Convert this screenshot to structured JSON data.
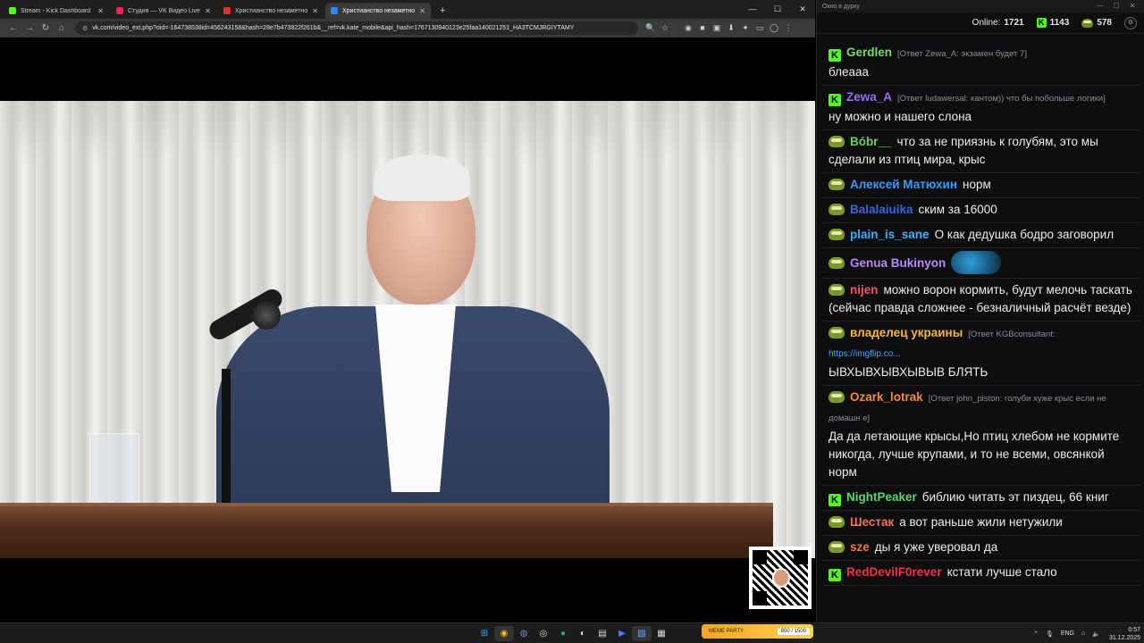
{
  "browser": {
    "tabs": [
      {
        "title": "Stream - Kick Dashboard",
        "fav_color": "#53fc18",
        "active": false
      },
      {
        "title": "Студия — VK Видео Live",
        "fav_color": "#e6245a",
        "active": false
      },
      {
        "title": "Христианство незаметно уходит",
        "fav_color": "#e62e2e",
        "active": false
      },
      {
        "title": "Христианство незаметно у",
        "fav_color": "#2787f5",
        "active": true
      }
    ],
    "new_tab": "+",
    "window_controls": {
      "minimize": "—",
      "maximize": "☐",
      "close": "✕"
    },
    "url": "vk.com/video_ext.php?oid=-164738538id=456243158&hash=28e7b473822f261b&__ref=vk.kate_mobile&api_hash=1767130940123e25faa140021251_HA3TCMJRGIYTAMY"
  },
  "chat": {
    "window_title": "Окно в дурку",
    "online_label": "Online:",
    "online_count": "1721",
    "kick_count": "1143",
    "vk_count": "578",
    "messages": [
      {
        "badge": "k",
        "user": "Gerdlen",
        "color": "#75d86a",
        "reply": "[Ответ Zewa_A: экзамен будет 7]",
        "link": "",
        "text": "блеааа",
        "emote": false
      },
      {
        "badge": "k",
        "user": "Zewa_A",
        "color": "#9c6bf5",
        "reply": "[Ответ ludawersal: кантом)) что бы побольше логики]",
        "link": "",
        "text": "ну можно и нашего слона",
        "emote": false
      },
      {
        "badge": "p",
        "user": "Bóbr__",
        "color": "#6fcf5a",
        "reply": "",
        "link": "",
        "text": "что за не приязнь к голубям, это мы сделали из птиц мира, крыс",
        "emote": false
      },
      {
        "badge": "p",
        "user": "Алексей Матюхин",
        "color": "#3b9cf6",
        "reply": "",
        "link": "",
        "text": "норм",
        "emote": false
      },
      {
        "badge": "p",
        "user": "Balalaiuika",
        "color": "#3f64d8",
        "reply": "",
        "link": "",
        "text": "ским за 16000",
        "emote": false
      },
      {
        "badge": "p",
        "user": "plain_is_sane",
        "color": "#3fb0f5",
        "reply": "",
        "link": "",
        "text": "О как дедушка бодро заговорил",
        "emote": false
      },
      {
        "badge": "p",
        "user": "Genua Bukinyon",
        "color": "#b58cf5",
        "reply": "",
        "link": "",
        "text": "",
        "emote": true
      },
      {
        "badge": "p",
        "user": "nijen",
        "color": "#e8596c",
        "reply": "",
        "link": "",
        "text": "можно ворон кормить, будут мелочь таскать (сейчас правда сложнее - безналичный расчёт везде)",
        "emote": false
      },
      {
        "badge": "p",
        "user": "владелец украины",
        "color": "#f4b63b",
        "reply": "[Ответ KGBconsultant:",
        "link": "https://imgflip.co...",
        "text": "ЫВХЫВХЫВХЫВЫВ БЛЯТЬ",
        "emote": false
      },
      {
        "badge": "p",
        "user": "Ozark_lotrak",
        "color": "#f08a3c",
        "reply": "[Ответ john_piston: голуби хуже крыс если не домашн е]",
        "link": "",
        "text": "Да да летающие крысы,Но птиц хлебом не кормите никогда, лучше крупами, и то не всеми, овсянкой норм",
        "emote": false
      },
      {
        "badge": "k",
        "user": "NightPeaker",
        "color": "#5bd66b",
        "reply": "",
        "link": "",
        "text": "библию читать эт пиздец, 66 книг",
        "emote": false
      },
      {
        "badge": "p",
        "user": "Шестак",
        "color": "#f0734e",
        "reply": "",
        "link": "",
        "text": "а вот раньше жили нетужили",
        "emote": false
      },
      {
        "badge": "p",
        "user": "sze",
        "color": "#f07a3c",
        "reply": "",
        "link": "",
        "text": "ды я уже уверовал да",
        "emote": false
      },
      {
        "badge": "k",
        "user": "RedDevilF0rever",
        "color": "#f0324b",
        "reply": "",
        "link": "",
        "text": "кстати лучше стало",
        "emote": false
      }
    ]
  },
  "taskbar": {
    "banner_text": "MEME PARTY",
    "banner_progress": "800 / 1500",
    "lang": "ENG",
    "time": "0:57",
    "date": "31.12.2025"
  }
}
